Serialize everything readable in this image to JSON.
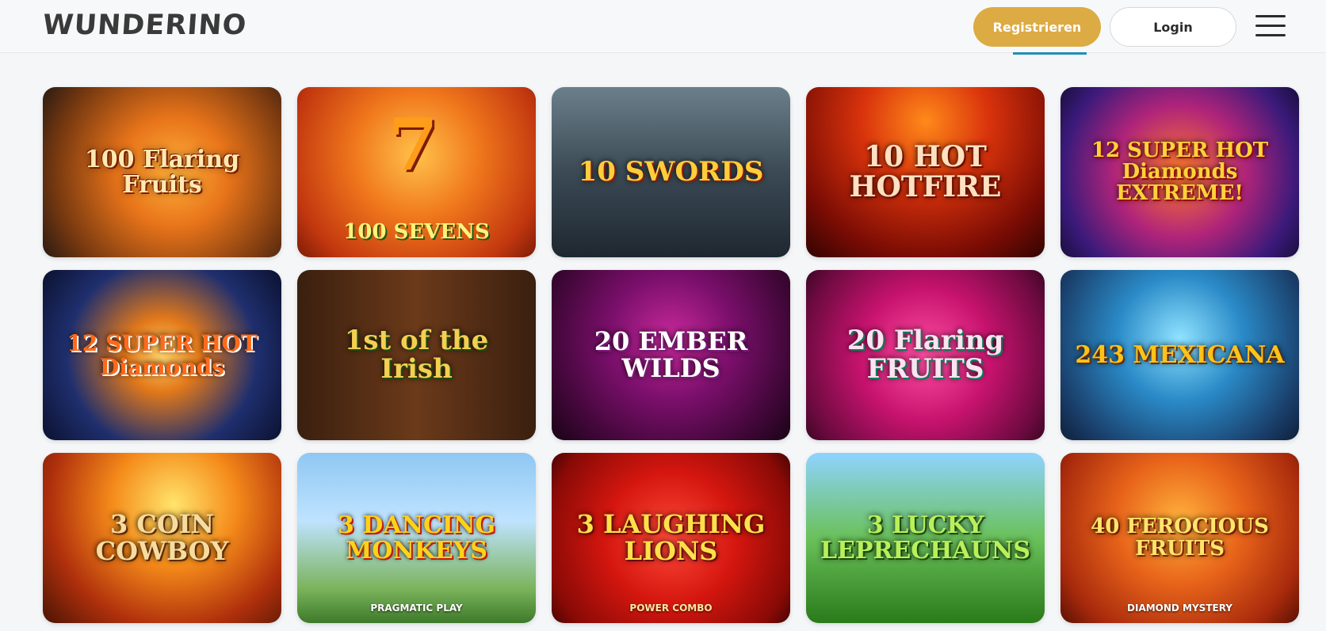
{
  "header": {
    "logo": "WUNDERINO",
    "register_label": "Registrieren",
    "login_label": "Login",
    "menu_icon": "hamburger-menu-icon"
  },
  "colors": {
    "accent": "#dcab44",
    "active_tab": "#1e8fb5",
    "background": "#f4f6f8"
  },
  "games": [
    {
      "title": "100 Flaring Fruits",
      "subtitle": ""
    },
    {
      "title": "100 SEVENS",
      "subtitle": ""
    },
    {
      "title": "10 SWORDS",
      "subtitle": ""
    },
    {
      "title": "10 HOT HOTFIRE",
      "subtitle": ""
    },
    {
      "title": "12 SUPER HOT Diamonds EXTREME!",
      "subtitle": ""
    },
    {
      "title": "12 SUPER HOT Diamonds",
      "subtitle": ""
    },
    {
      "title": "1st of the Irish",
      "subtitle": ""
    },
    {
      "title": "20 EMBER WILDS",
      "subtitle": ""
    },
    {
      "title": "20 Flaring FRUITS",
      "subtitle": ""
    },
    {
      "title": "243 MEXICANA",
      "subtitle": ""
    },
    {
      "title": "3 COIN COWBOY",
      "subtitle": ""
    },
    {
      "title": "3 DANCING MONKEYS",
      "subtitle": "PRAGMATIC PLAY"
    },
    {
      "title": "3 LAUGHING LIONS",
      "subtitle": "POWER COMBO"
    },
    {
      "title": "3 LUCKY LEPRECHAUNS",
      "subtitle": ""
    },
    {
      "title": "40 FEROCIOUS FRUITS",
      "subtitle": "DIAMOND MYSTERY"
    }
  ]
}
